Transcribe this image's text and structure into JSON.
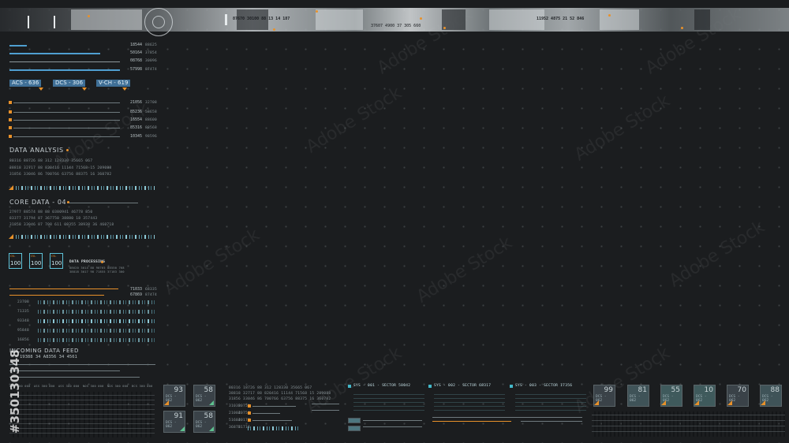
{
  "watermark": "Adobe Stock",
  "stock_id": "#350130348",
  "top": {
    "num1": "87670 30100 88 13 14 187",
    "num2": "11952 4875 21 52 846",
    "num3": "37607 4900 37 305 660"
  },
  "left_panel": {
    "bars": [
      "18544",
      "50164",
      "08768",
      "57998"
    ],
    "bars_small": [
      "88625",
      "37854",
      "30096",
      "87474"
    ],
    "tags": [
      "ACS - 636",
      "DCS - 306",
      "V-CH - 619"
    ],
    "slider_vals": [
      "21056",
      "85236",
      "16554",
      "85316",
      "10345"
    ],
    "slider_vals2": [
      "32708",
      "58658",
      "88600",
      "88568",
      "98596"
    ],
    "data_analysis": "DATA ANALYSIS",
    "da_rows": [
      "80316 88726  88  312  128330  35665  067",
      "38818 32717  88  820416  11144  71568  15  209088",
      "31856 33046  86  700766  63756  88375  16  360782"
    ],
    "core_data": "CORE DATA - 04",
    "cd_rows": [
      "27977 88574  88  88  0380941  46778  850",
      "83377 31794  87  367750  38880  18  357443",
      "31858 33046  87  708  611 08355  38938  36  460718"
    ],
    "badges": [
      {
        "t": "CVL",
        "n": "100"
      },
      {
        "t": "CVL",
        "n": "100"
      },
      {
        "t": "CVL",
        "n": "100"
      }
    ],
    "processing": "DATA PROCESSING",
    "proc_rows": [
      "88620 3014  88  90765  88550  768",
      "38818 3017  98  71855  37183  300"
    ],
    "orange_vals": [
      "71033",
      "67869"
    ],
    "orange_vals2": [
      "68335",
      "87474"
    ],
    "stream_vals": [
      "23708",
      "71335",
      "93348",
      "95848",
      "16856"
    ],
    "incoming": "INCOMING DATA FEED",
    "feed_row": "19388  34  A8356  34  4561",
    "col_heads": [
      "ASS 300 000",
      "ASS 300 000",
      "ASS 300 000",
      "NOS 300 000",
      "NOS 300 000",
      "BCS 300 000"
    ]
  },
  "bottom": {
    "cells_left": [
      {
        "v": "93",
        "l": "DCS - 062"
      },
      {
        "v": "58",
        "l": "DCS - 062"
      },
      {
        "v": "91",
        "l": "DCS - 062"
      },
      {
        "v": "58",
        "l": "DCS - 062"
      }
    ],
    "mid_rows": [
      "80316 18726  88  312  128330  35665  067",
      "38818 32717  88  820416  11144  71568  15  209088",
      "31856 33046  86  700766  63756  88375  16  360782"
    ],
    "slider_labels": [
      "31038",
      "21004",
      "51604",
      "36878"
    ],
    "slider_labels2": [
      "30758",
      "20756",
      "30176",
      "31718"
    ],
    "sys": [
      "SYS - 001 - SECTOR 58042",
      "SYS - 002 - SECTOR 68317",
      "SYS - 003 - SECTOR 17356"
    ],
    "cells_right": [
      {
        "v": "99",
        "l": "DCS - 062"
      },
      {
        "v": "81",
        "l": "DCS - 062"
      },
      {
        "v": "55",
        "l": "DCS - 062"
      },
      {
        "v": "10",
        "l": "DCS - 062"
      },
      {
        "v": "70",
        "l": "DCS - 062"
      },
      {
        "v": "88",
        "l": "DCS - 062"
      }
    ]
  },
  "colors": {
    "accent": "#e8912a",
    "cyan": "#43b8c9",
    "blue": "#4f9fd1",
    "bg": "#1b1d1f"
  }
}
